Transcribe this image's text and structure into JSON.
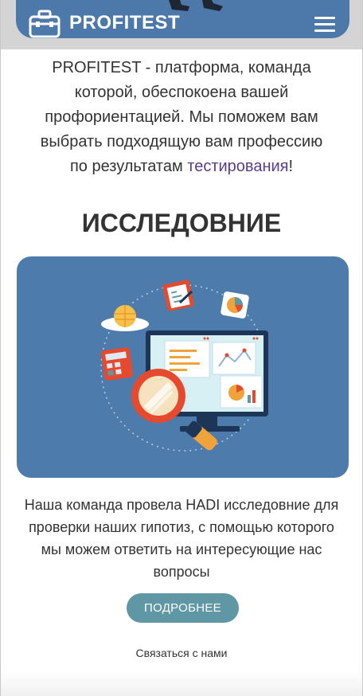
{
  "header": {
    "brand": "PROFITEST",
    "logo_icon": "briefcase-icon",
    "menu_icon": "hamburger-menu-icon",
    "accent_color": "#4c78aa"
  },
  "intro": {
    "text_before_link": "PROFITEST - платформа, команда которой, обеспокоена вашей профориентацией. Мы поможем вам выбрать подходящую вам профессию по результатам ",
    "link_text": "тестирования",
    "text_after_link": "!"
  },
  "research": {
    "title": "ИССЛЕДОВНИЕ",
    "illustration": "research-analytics-illustration",
    "description": "Наша команда провела HADI исследовние для проверки наших гипотиз, с помощью которого мы можем ответить на интересующие нас вопросы",
    "more_button": "ПОДРОБНЕЕ",
    "button_color": "#5f97a4"
  },
  "footer": {
    "contact_link": "Связаться с нами"
  }
}
